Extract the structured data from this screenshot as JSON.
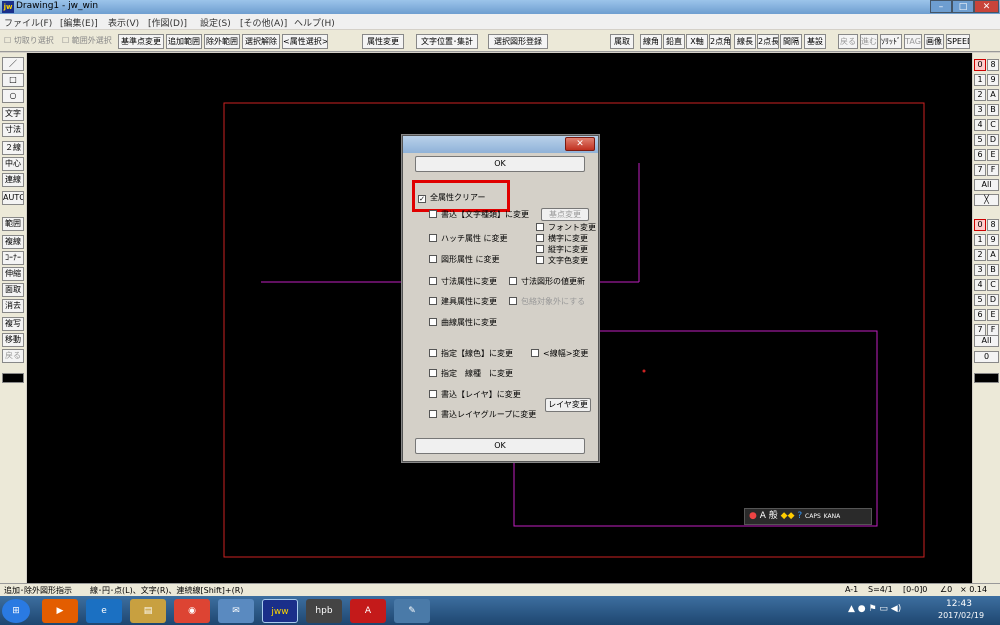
{
  "window": {
    "title": "Drawing1 - jw_win",
    "logo": "jw",
    "min": "–",
    "max": "□",
    "close": "✕"
  },
  "menu": [
    "ファイル(F)",
    "[編集(E)]",
    "表示(V)",
    "[作図(D)]",
    "設定(S)",
    "[その他(A)]",
    "ヘルプ(H)"
  ],
  "toolbar": {
    "cb1": "切取り選択",
    "cb2": "範囲外選択",
    "btn_kijun": "基準点変更",
    "btn_tsuika": "追加範囲",
    "btn_jogai": "除外範囲",
    "btn_kaijo": "選択解除",
    "btn_zokusei_sentaku": "<属性選択>",
    "btn_zokusei_henkou": "属性変更",
    "btn_moji": "文字位置･集計",
    "btn_toroku": "選択図形登録",
    "r": [
      "属取",
      "線角",
      "鉛直",
      "X軸",
      "2点角",
      "線長",
      "2点長",
      "間隔",
      "基設",
      "戻る",
      "進む",
      "ｿﾘｯﾄﾞ",
      "TAG",
      "画像",
      "SPEED"
    ]
  },
  "left_tools": [
    "／",
    "□",
    "○",
    "文字",
    "寸法",
    "２線",
    "中心線",
    "連線",
    "AUTO",
    "範囲",
    "複線",
    "ｺｰﾅｰ",
    "伸縮",
    "面取",
    "消去",
    "複写",
    "移動",
    "戻る"
  ],
  "right_tools": {
    "col1": [
      "0",
      "1",
      "2",
      "3",
      "4",
      "5",
      "6",
      "7"
    ],
    "col2": [
      "8",
      "9",
      "A",
      "B",
      "C",
      "D",
      "E",
      "F"
    ],
    "all1": "All",
    "x": "╳",
    "col3": [
      "0",
      "1",
      "2",
      "3",
      "4",
      "5",
      "6",
      "7"
    ],
    "col4": [
      "8",
      "9",
      "A",
      "B",
      "C",
      "D",
      "E",
      "F"
    ],
    "all2": "All",
    "zero": "0"
  },
  "dialog": {
    "close": "✕",
    "ok_top": "OK",
    "ok_bottom": "OK",
    "all_clear": "全属性クリアー",
    "moji_shu": "書込【文字種類】に変更",
    "kijun_btn": "基点変更",
    "font": "フォント変更",
    "hatch": "ハッチ属性 に変更",
    "yoko": "横字に変更",
    "tate": "縦字に変更",
    "zukei": "図形属性 に変更",
    "mojiiro": "文字色変更",
    "sunpo": "寸法属性に変更",
    "sunpo_atai": "寸法図形の値更新",
    "tategu": "建具属性に変更",
    "hokatsu": "包絡対象外にする",
    "kyokusen": "曲線属性に変更",
    "senshoku": "指定【線色】に変更",
    "senpuku": "<線幅>変更",
    "senshu": "指定　線種　に変更",
    "layer": "書込【レイヤ】に変更",
    "layer_btn": "レイヤ変更",
    "layer_group": "書込レイヤグループに変更",
    "checked_mark": "✓"
  },
  "status": {
    "left": "追加･除外図形指示",
    "mid": "線･円･点(L)、文字(R)、連続線[Shift]+(R)",
    "a": "A-1",
    "s": "S=4/1",
    "l": "[0-0]0",
    "ang": "∠0",
    "scale": "× 0.14"
  },
  "taskbar": {
    "apps": [
      "⊞",
      "▶",
      "e",
      "▤",
      "◉",
      "✉",
      "jww",
      "hpb",
      "A",
      "✎"
    ],
    "time": "12:43",
    "date": "2017/02/19"
  },
  "ime": {
    "a": "A",
    "kan": "般",
    "caps": "CAPS",
    "kana": "KANA"
  },
  "colors": {
    "canvas": "#000000",
    "red_frame": "#cc2222",
    "magenta": "#c020c0",
    "highlight": "#e00000"
  }
}
